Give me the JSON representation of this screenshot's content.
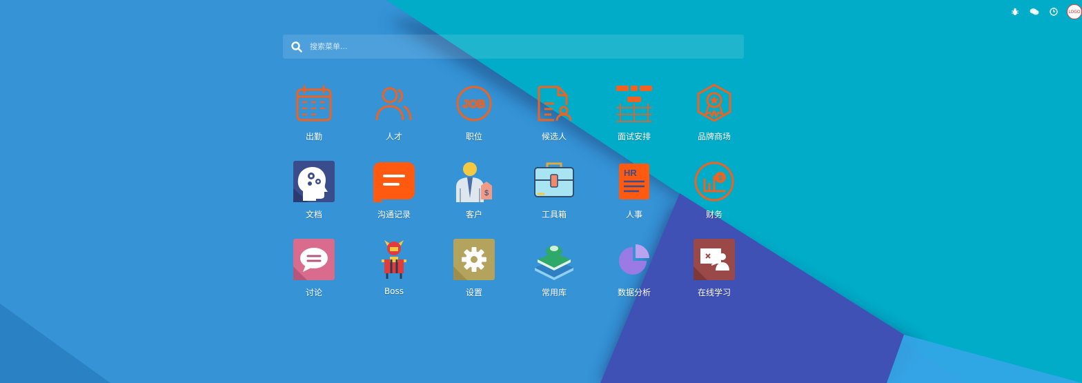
{
  "search": {
    "placeholder": "搜索菜单..."
  },
  "topbar": {
    "icons": [
      "bug-icon",
      "chat-icon",
      "clock-icon"
    ],
    "avatar_text": "LOGO"
  },
  "apps": [
    {
      "label": "出勤"
    },
    {
      "label": "人才"
    },
    {
      "label": "职位"
    },
    {
      "label": "候选人"
    },
    {
      "label": "面试安排"
    },
    {
      "label": "品牌商场"
    },
    {
      "label": "文档"
    },
    {
      "label": "沟通记录"
    },
    {
      "label": "客户"
    },
    {
      "label": "工具箱"
    },
    {
      "label": "人事"
    },
    {
      "label": "财务"
    },
    {
      "label": "讨论"
    },
    {
      "label": "Boss"
    },
    {
      "label": "设置"
    },
    {
      "label": "常用库"
    },
    {
      "label": "数据分析"
    },
    {
      "label": "在线学习"
    }
  ],
  "colors": {
    "bg_blue": "#3593d6",
    "bg_teal": "#00acc7",
    "bg_indigo": "#3b4fb0",
    "icon_orange": "#f0621f"
  }
}
